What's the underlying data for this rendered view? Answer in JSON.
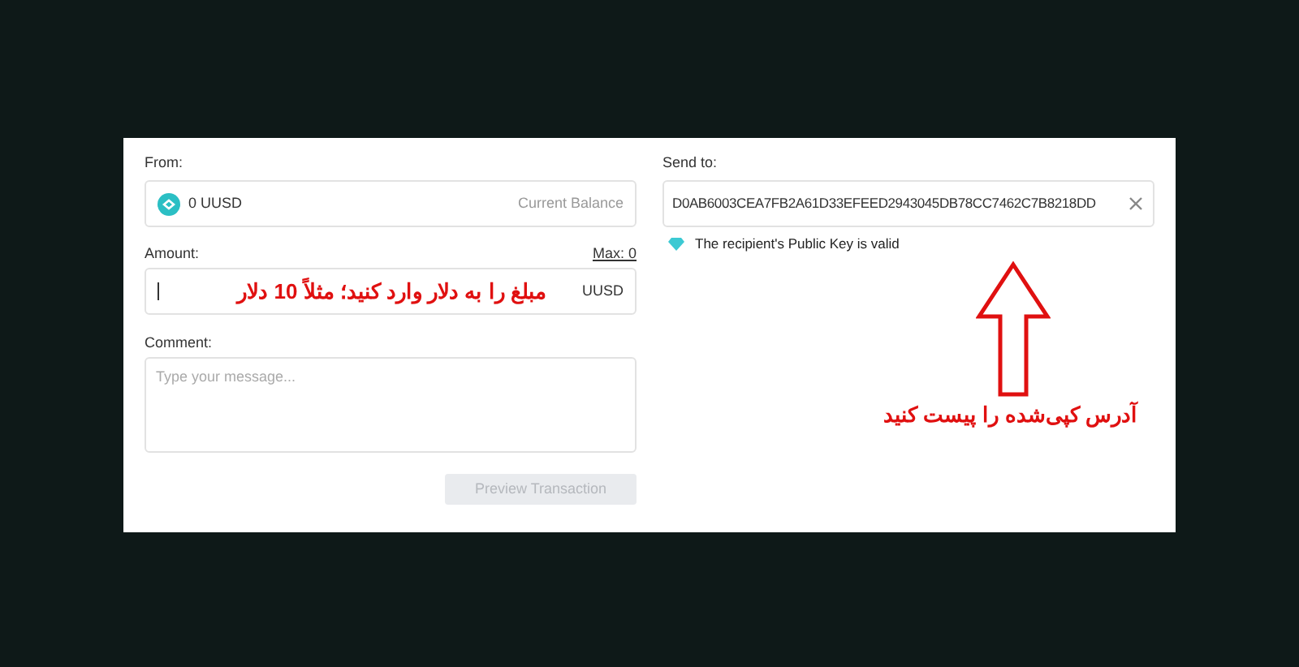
{
  "from": {
    "label": "From:",
    "amount": "0 UUSD",
    "hint": "Current Balance"
  },
  "amount": {
    "label": "Amount:",
    "max": "Max: 0",
    "unit": "UUSD",
    "annotation": "مبلغ را به دلار وارد کنید؛ مثلاً 10 دلار"
  },
  "comment": {
    "label": "Comment:",
    "placeholder": "Type your message..."
  },
  "preview_button": {
    "label": "Preview Transaction",
    "disabled": true
  },
  "send_to": {
    "label": "Send to:",
    "value": "D0AB6003CEA7FB2A61D33EFEED2943045DB78CC7462C7B8218DD",
    "valid": true,
    "status": "The recipient's Public Key is valid",
    "annotation": "آدرس کپی‌شده را پیست کنید"
  }
}
